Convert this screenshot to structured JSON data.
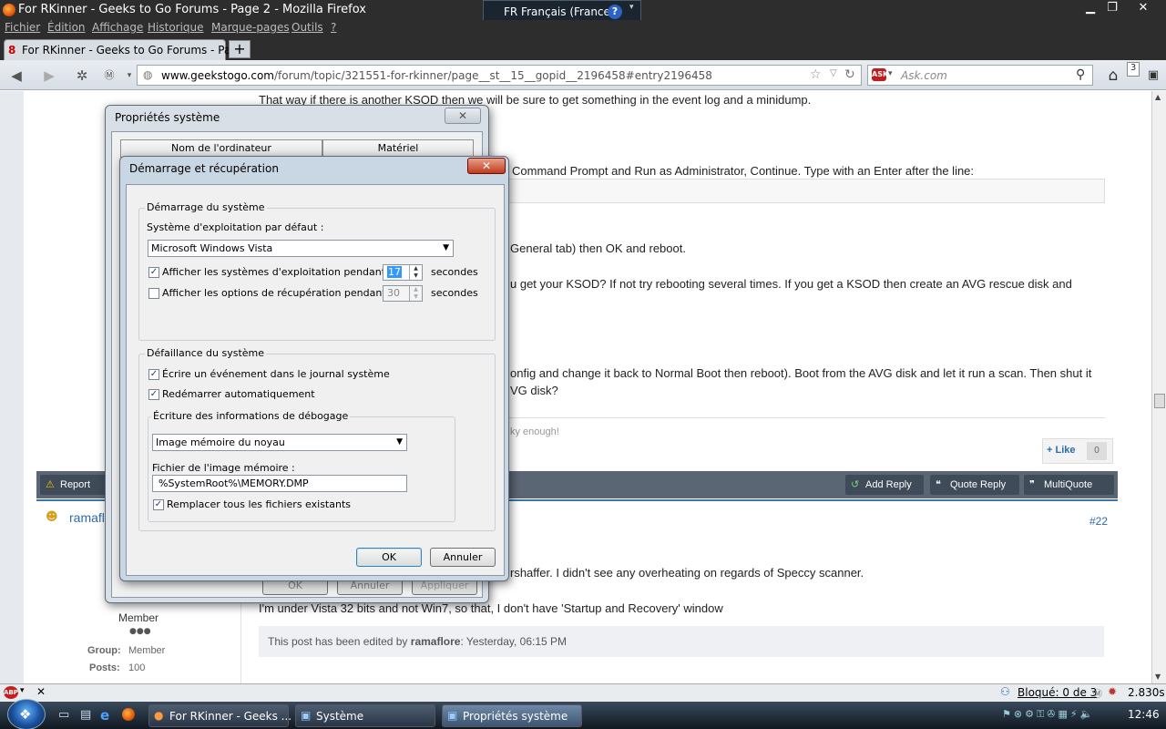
{
  "window": {
    "title": "For RKinner - Geeks to Go Forums - Page 2 - Mozilla Firefox"
  },
  "language_bar": {
    "label": "FR Français (France)",
    "help": "?"
  },
  "menus": [
    "Fichier",
    "Édition",
    "Affichage",
    "Historique",
    "Marque-pages",
    "Outils",
    "?"
  ],
  "tab": {
    "title": "For RKinner - Geeks to Go Forums - Pag...",
    "new_tab": "+"
  },
  "nav": {
    "url_domain": "www.geekstogo.com",
    "url_path": "/forum/topic/321551-for-rkinner/page__st__15__gopid__2196458#entry2196458",
    "search_placeholder": "Ask.com",
    "badge": "3"
  },
  "post": {
    "line1": "That way if there is another KSOD then we will be sure to get something in the event log and a minidump.",
    "line2": "Command Prompt and Run as Administrator, Continue. Type with an Enter after the line:",
    "line3": "General tab) then OK and reboot.",
    "line4": "u get your KSOD? If not try rebooting several times. If you get a KSOD then create an AVG rescue disk and",
    "line5": "onfig and change it back to Normal Boot then reboot). Boot from the AVG disk and let it run a scan. Then shut it",
    "line6": "VG disk?",
    "signature": "ky enough!",
    "like_label": "+ Like",
    "like_count": "0"
  },
  "actions": {
    "report": "Report",
    "add_reply": "Add Reply",
    "quote_reply": "Quote Reply",
    "multiquote": "MultiQuote"
  },
  "reply": {
    "author": "ramafl",
    "post_number": "#22",
    "line1": "rshaffer. I didn't see any overheating on regards of Speccy scanner.",
    "line2": "I'm under Vista 32 bits and not Win7, so that, I don't have 'Startup and Recovery' window",
    "edited_prefix": "This post has been edited by ",
    "edited_by": "ramaflore",
    "edited_time": ": Yesterday, 06:15 PM",
    "role": "Member",
    "group_label": "Group:",
    "group_value": "Member",
    "posts_label": "Posts:",
    "posts_value": "100"
  },
  "status": {
    "blocked": "Bloqué: 0 de 3",
    "time": "2.830s"
  },
  "taskbar": {
    "items": [
      "For RKinner - Geeks ...",
      "Système",
      "Propriétés système"
    ],
    "clock": "12:46"
  },
  "sysprops": {
    "title": "Propriétés système",
    "tab1": "Nom de l'ordinateur",
    "tab2": "Matériel",
    "ok": "OK",
    "cancel": "Annuler",
    "apply": "Appliquer"
  },
  "startup_dialog": {
    "title": "Démarrage et récupération",
    "startup_group": "Démarrage du système",
    "default_os_label": "Système d'exploitation par défaut :",
    "default_os_value": "Microsoft Windows Vista",
    "show_os_label": "Afficher les systèmes d'exploitation pendant :",
    "show_os_value": "17",
    "show_recovery_label": "Afficher les options de récupération pendant :",
    "show_recovery_value": "30",
    "seconds": "secondes",
    "failure_group": "Défaillance du système",
    "write_event": "Écrire un événement dans le journal système",
    "auto_restart": "Redémarrer automatiquement",
    "debug_group": "Écriture des informations de débogage",
    "debug_value": "Image mémoire du noyau",
    "dump_file_label": "Fichier de l'image mémoire :",
    "dump_file_value": "%SystemRoot%\\MEMORY.DMP",
    "overwrite": "Remplacer tous les fichiers existants",
    "ok": "OK",
    "cancel": "Annuler"
  }
}
